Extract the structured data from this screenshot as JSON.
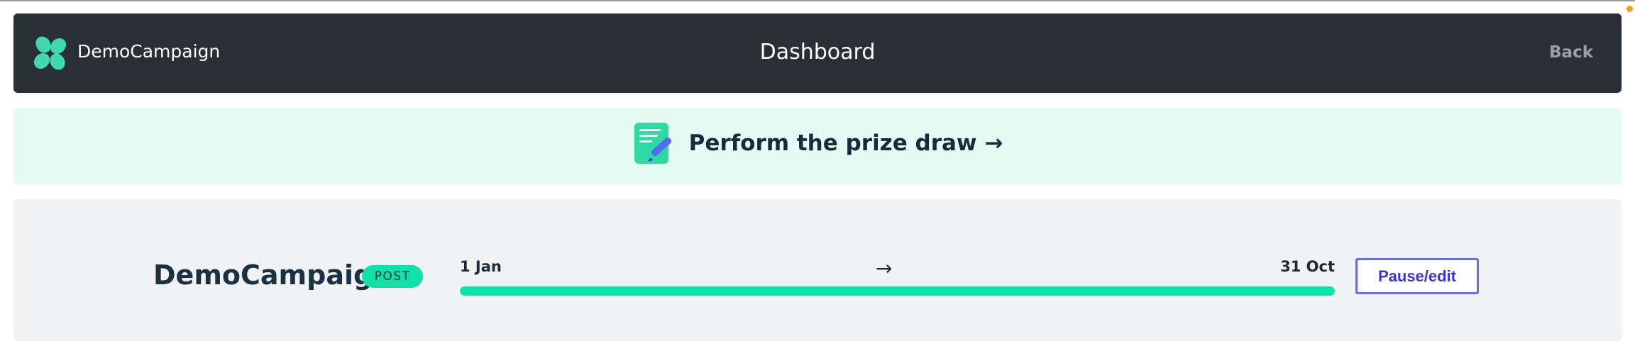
{
  "header": {
    "brand_name": "DemoCampaign",
    "logo_icon": "clover-icon",
    "page_title": "Dashboard",
    "back_label": "Back"
  },
  "banner": {
    "icon": "notepad-pencil-icon",
    "label": "Perform the prize draw →"
  },
  "campaign": {
    "name": "DemoCampaign",
    "status_badge": "POST",
    "start_date": "1 Jan",
    "arrow": "→",
    "end_date": "31 Oct",
    "progress_percent": 100,
    "action_label": "Pause/edit"
  },
  "colors": {
    "header_bg": "#293033",
    "accent": "#11e0a9",
    "banner_bg": "#e7fbf4",
    "card_bg": "#f0f2f4",
    "button_text": "#3a36d0"
  }
}
